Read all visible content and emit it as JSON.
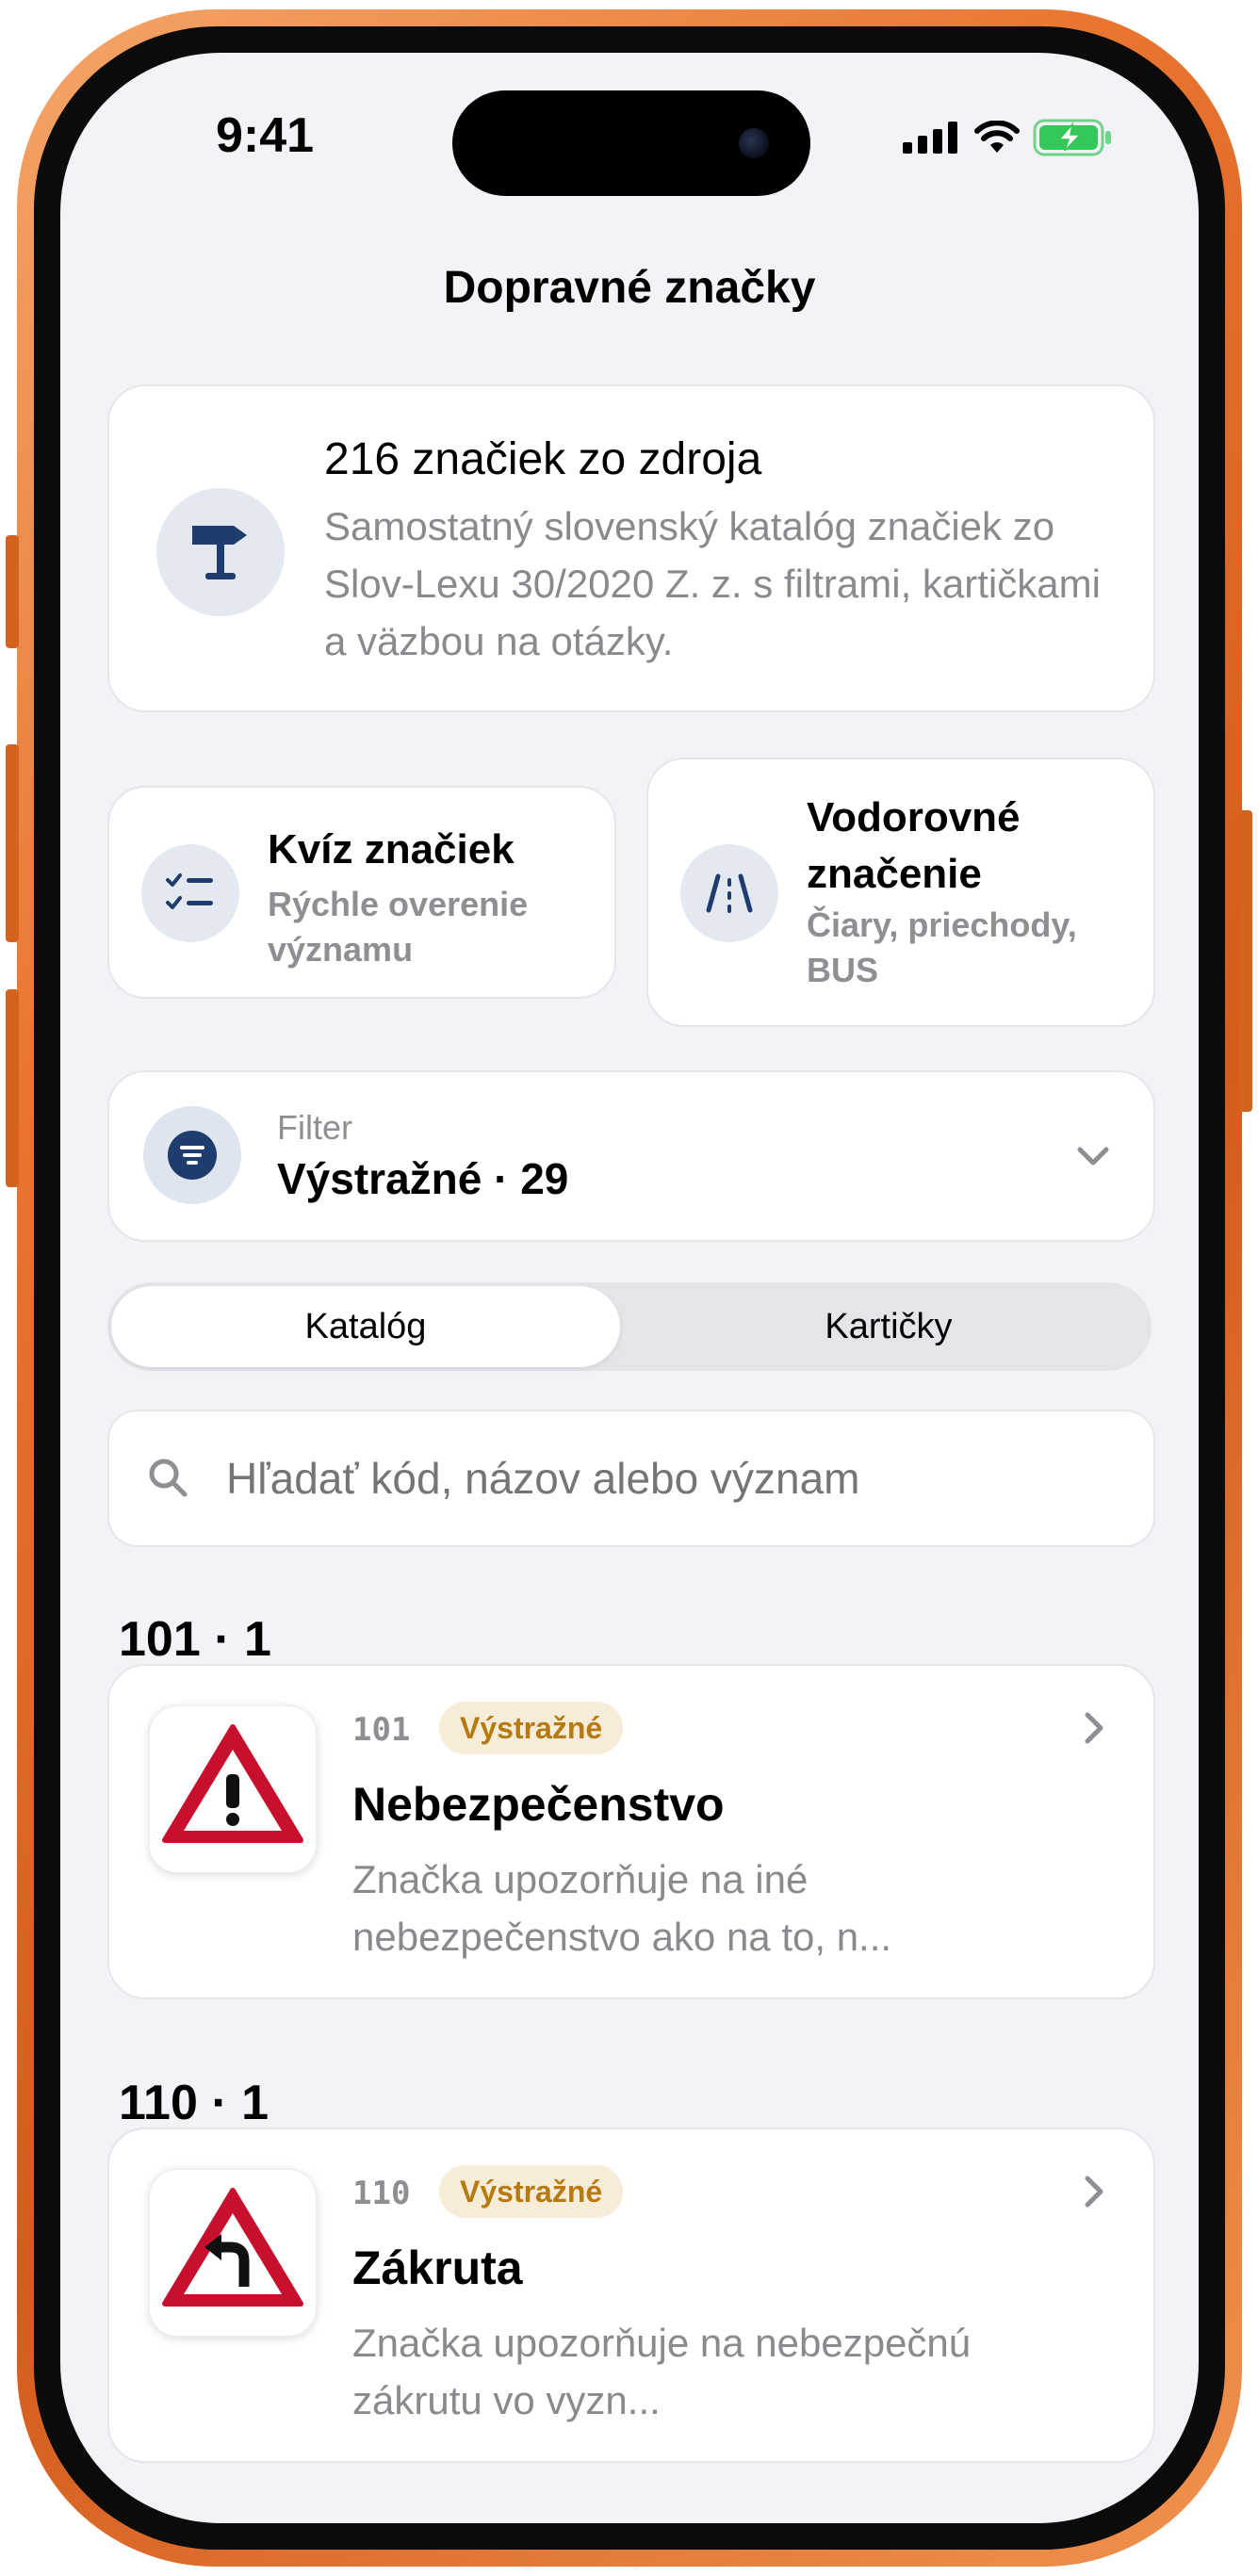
{
  "status": {
    "time": "9:41"
  },
  "nav": {
    "title": "Dopravné značky"
  },
  "hero": {
    "icon": "signpost-icon",
    "title": "216 značiek zo zdroja",
    "description": "Samostatný slovenský katalóg značiek zo Slov-Lexu 30/2020 Z. z. s filtrami, kartičkami a väzbou na otázky."
  },
  "tiles": [
    {
      "title": "Kvíz značiek",
      "subtitle": "Rýchle overenie významu",
      "icon": "checklist-icon"
    },
    {
      "title": "Vodorovné značenie",
      "subtitle": "Čiary, priechody, BUS",
      "icon": "road-markings-icon"
    }
  ],
  "filter": {
    "label": "Filter",
    "value": "Výstražné · 29"
  },
  "segments": {
    "catalog": "Katalóg",
    "cards": "Kartičky",
    "selected": "Katalóg"
  },
  "search": {
    "placeholder": "Hľadať kód, názov alebo význam"
  },
  "sections": [
    {
      "header": "101 · 1",
      "item": {
        "code": "101",
        "category": "Výstražné",
        "title": "Nebezpečenstvo",
        "description": "Značka upozorňuje na iné nebezpečenstvo ako na to, n..."
      }
    },
    {
      "header": "110 · 1",
      "item": {
        "code": "110",
        "category": "Výstražné",
        "title": "Zákruta",
        "description": "Značka upozorňuje na nebezpečnú zákrutu vo vyzn..."
      }
    }
  ],
  "colors": {
    "accent": "#1f3c6e",
    "badge_bg": "#f6ecd8",
    "badge_text": "#b67a11",
    "frame": "#e8742f",
    "sign_red": "#c8102e"
  }
}
